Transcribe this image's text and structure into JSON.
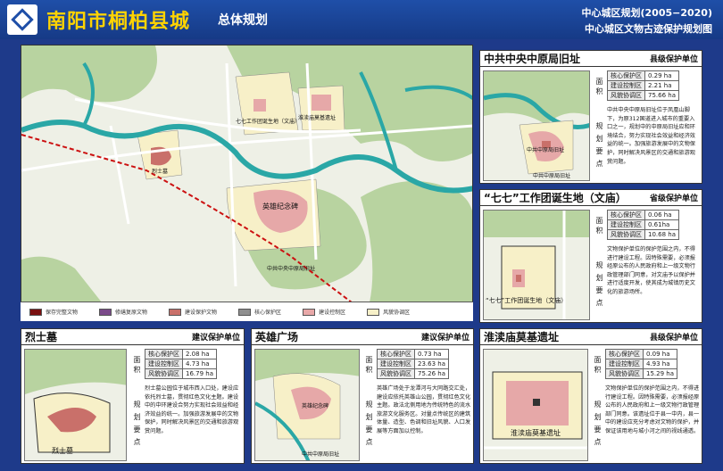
{
  "header": {
    "title": "南阳市桐柏县城",
    "subtitle": "总体规划",
    "right_top": "中心城区规划(2005−2020)",
    "right_bottom": "中心城区文物古迹保护规划图"
  },
  "map": {
    "labels": {
      "site1": "七七工作团诞生地（文庙）",
      "site2": "淮渎庙莫基遗址",
      "site3": "烈士墓",
      "site4": "英雄纪念碑",
      "site5": "中共中央中原局旧址"
    }
  },
  "legend": [
    {
      "label": "保存完整文物",
      "color": "#7a1010"
    },
    {
      "label": "修缮复原文物",
      "color": "#7b4b8a"
    },
    {
      "label": "建设保护文物",
      "color": "#c9706a"
    },
    {
      "label": "核心保护区",
      "color": "#8f8f8f"
    },
    {
      "label": "建设控制区",
      "color": "#e8a8a8"
    },
    {
      "label": "风貌协调区",
      "color": "#f7f0c8"
    }
  ],
  "panels": {
    "zhongyuan": {
      "name": "中共中央中原局旧址",
      "level": "县级保护单位",
      "area_label": "面积",
      "key_label": "规划要点",
      "rows": [
        {
          "k": "核心保护区",
          "v": "0.29 ha"
        },
        {
          "k": "建设控制区",
          "v": "2.21 ha"
        },
        {
          "k": "风貌协调区",
          "v": "75.66 ha"
        }
      ],
      "desc": "中共中央中原局旧址位于凤凰山脚下，为原312国道进入城市的重要入口之一，规划中的中原局旧址应和环境结合，努力实现社会效益和经济效益的统一。加强旅游发展中的文物保护，同时解决风景区的交通和旅游观赏问题。",
      "map_label": "中共中原局旧址",
      "map_label2": "中共中原局旧址"
    },
    "wenmiao": {
      "name": "“七七”工作团诞生地（文庙）",
      "level": "省级保护单位",
      "area_label": "面积",
      "key_label": "规划要点",
      "rows": [
        {
          "k": "核心保护区",
          "v": "0.06 ha"
        },
        {
          "k": "建设控制区",
          "v": "0.61ha"
        },
        {
          "k": "风貌协调区",
          "v": "10.68 ha"
        }
      ],
      "desc": "文物保护单位的保护范围之内，不得进行建设工程。因特殊需要，必须报经原公布的人民政府和上一级文物行政管理部门同意，对文庙予以保护并进行适度开发，使其成为城镇历史文化的旅游场所。",
      "map_label": "“七七”工作团诞生地（文庙）"
    },
    "lieshi": {
      "name": "烈士墓",
      "level": "建议保护单位",
      "area_label": "面积",
      "key_label": "规划要点",
      "rows": [
        {
          "k": "核心保护区",
          "v": "2.08 ha"
        },
        {
          "k": "建设控制区",
          "v": "4.73 ha"
        },
        {
          "k": "风貌协调区",
          "v": "16.79 ha"
        }
      ],
      "desc": "烈士墓公园位于城市西入口处，建设应依托烈士墓，贯彻红色文化主题。建设中的中环建设合努力实现社会效益和经济效益的统一。加强旅游发展中的文物保护，同时解决风景区的交通和旅游观赏问题。",
      "map_label": "烈士墓"
    },
    "yingxiong": {
      "name": "英雄广场",
      "level": "建议保护单位",
      "area_label": "面积",
      "key_label": "规划要点",
      "rows": [
        {
          "k": "核心保护区",
          "v": "0.73 ha"
        },
        {
          "k": "建设控制区",
          "v": "23.63 ha"
        },
        {
          "k": "风貌协调区",
          "v": "75.26 ha"
        }
      ],
      "desc": "英雄广场处于龙潭河与大同路交汇处，建设应依托英雄山公园，贯彻红色文化主题。政法北侧用地为传统特色的流水旅游文化服务区。对量点传统区的建筑体量、造型、色调和旧址风貌、人口发展等方面加以控制。",
      "map_label": "英雄纪念碑",
      "map_label2": "中共中原局旧址"
    },
    "huaidu": {
      "name": "淮渎庙莫基遗址",
      "level": "县级保护单位",
      "area_label": "面积",
      "key_label": "规划要点",
      "rows": [
        {
          "k": "核心保护区",
          "v": "0.09 ha"
        },
        {
          "k": "建设控制区",
          "v": "4.93 ha"
        },
        {
          "k": "风貌协调区",
          "v": "15.29 ha"
        }
      ],
      "desc": "文物保护单位的保护范围之内，不得进行建设工程。因特殊需要，必须报经原公布的人民政府和上一级文物行政管理部门同意。该遗址位于县一中内，县一中的建设应充分考虑对文物的保护，并保证该用地与城小河之间的视线通透。",
      "map_label": "淮渎庙莫基遗址"
    }
  },
  "colors": {
    "frame": "#1e3a8a",
    "river": "#2aa7a6",
    "green": "#b8d3a0",
    "road": "#ffffff",
    "rail": "#cc1111",
    "protect": "#e6a8a8",
    "core": "#c9706a",
    "harmony": "#f7f0c8"
  }
}
